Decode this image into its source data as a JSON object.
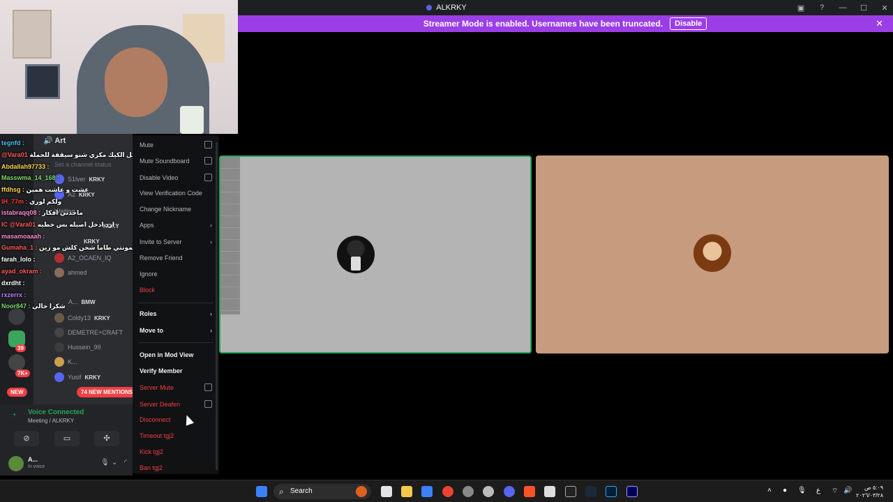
{
  "window": {
    "title": "ALKRKY"
  },
  "banner": {
    "text": "Streamer Mode is enabled. Usernames have been truncated.",
    "disable_label": "Disable",
    "color": "#9b3ee6"
  },
  "sidebar": {
    "channel": "Art",
    "channel_status_placeholder": "Set a channel status",
    "members": [
      {
        "name": "S1lver",
        "tag": "KRKY"
      },
      {
        "name": "A2",
        "tag": "KRKY"
      },
      {
        "name": "Waiting"
      },
      {
        "name": "",
        "tag": "KRKY"
      },
      {
        "name": "",
        "tag": "KRKY"
      },
      {
        "name": "A2_OCAEN_IQ"
      },
      {
        "name": "ahmed"
      },
      {
        "name": "A...",
        "tag": "BMW"
      },
      {
        "name": "Coldy13",
        "tag": "KRKY"
      },
      {
        "name": "DEMETRE+CRAFT"
      },
      {
        "name": "Hussein_99"
      },
      {
        "name": "K..."
      },
      {
        "name": "Yusif",
        "tag": "KRKY"
      }
    ],
    "mentions_label": "74 NEW MENTIONS",
    "new_label": "NEW",
    "rail_badges": [
      "39",
      "7K+"
    ]
  },
  "chat_overlay": [
    {
      "user": "tegnfd :",
      "color": "#4fc3f7",
      "msg": ""
    },
    {
      "user": "@Vara01",
      "color": "#ff5a5a",
      "msg": "هاي مشاكل الكيك مكري شنو سيقفة للحملة"
    },
    {
      "user": "Abdallah97733 :",
      "color": "#ffd54f",
      "msg": ""
    },
    {
      "user": "Masswma_14_168 :",
      "color": "#7fdb6a",
      "msg": ""
    },
    {
      "user": "ffdhsg :",
      "color": "#ffd54f",
      "msg": "عشت و عاشت همين"
    },
    {
      "user": "IH_77m :",
      "color": "#ff3b3b",
      "msg": "ولكم لوري"
    },
    {
      "user": "istabraqq08 :",
      "color": "#ff8bd1",
      "msg": "ماخذني افكار"
    },
    {
      "user": "IC @Vara01",
      "color": "#ff5a5a",
      "msg": "ارد ادخل اصيله بس خطيه"
    },
    {
      "user": "masamoaaah :",
      "color": "#ff8bd1",
      "msg": ""
    },
    {
      "user": "Gumaha_1 :",
      "color": "#ff5a5a",
      "msg": "اي خطيه اني حته يمونتي طاما شحن كلش مو زين"
    },
    {
      "user": "farah_lolo :",
      "color": "#ffffff",
      "msg": ""
    },
    {
      "user": "ayad_okram :",
      "color": "#ff5a5a",
      "msg": ""
    },
    {
      "user": "dxrdht :",
      "color": "#ffffff",
      "msg": ""
    },
    {
      "user": "rxzerrx :",
      "color": "#c77dff",
      "msg": ""
    },
    {
      "user": "Noor847 :",
      "color": "#7fdb6a",
      "msg": "شكرا خالي"
    }
  ],
  "voice": {
    "status": "Voice Connected",
    "location": "Meeting / ALKRKY"
  },
  "user": {
    "name": "A...",
    "status": "In voice"
  },
  "context_menu": {
    "items": [
      {
        "label": "Mute",
        "kind": "checkbox",
        "style": "dim"
      },
      {
        "label": "Mute Soundboard",
        "kind": "checkbox",
        "style": "dim"
      },
      {
        "label": "Disable Video",
        "kind": "checkbox",
        "style": "dim"
      },
      {
        "label": "View Verification Code",
        "kind": "plain",
        "style": "dim"
      },
      {
        "label": "Change Nickname",
        "kind": "plain",
        "style": "dim"
      },
      {
        "label": "Apps",
        "kind": "submenu",
        "style": "dim"
      },
      {
        "label": "Invite to Server",
        "kind": "submenu",
        "style": "dim"
      },
      {
        "label": "Remove Friend",
        "kind": "plain",
        "style": "dim"
      },
      {
        "label": "Ignore",
        "kind": "plain",
        "style": "dim"
      },
      {
        "label": "Block",
        "kind": "plain",
        "style": "danger"
      },
      {
        "label": "Roles",
        "kind": "submenu",
        "style": "bright"
      },
      {
        "label": "Move to",
        "kind": "submenu",
        "style": "bright"
      },
      {
        "label": "Open in Mod View",
        "kind": "plain",
        "style": "bright"
      },
      {
        "label": "Verify Member",
        "kind": "plain",
        "style": "bright"
      },
      {
        "label": "Server Mute",
        "kind": "checkbox",
        "style": "danger"
      },
      {
        "label": "Server Deafen",
        "kind": "checkbox",
        "style": "danger"
      },
      {
        "label": "Disconnect",
        "kind": "plain",
        "style": "danger"
      },
      {
        "label": "Timeout tgj2",
        "kind": "plain",
        "style": "danger"
      },
      {
        "label": "Kick tgj2",
        "kind": "plain",
        "style": "danger"
      },
      {
        "label": "Ban tgj2",
        "kind": "plain",
        "style": "danger"
      }
    ]
  },
  "stage": {
    "tiles": [
      {
        "speaking": true,
        "bg": "#b4b4b4"
      },
      {
        "speaking": false,
        "bg": "#c79b7e"
      }
    ]
  },
  "taskbar": {
    "search_label": "Search",
    "clock_time": "٥:٠٩ ص",
    "clock_date": "٢٠٢٦/٠٣/٢٨",
    "lang": "ع"
  }
}
